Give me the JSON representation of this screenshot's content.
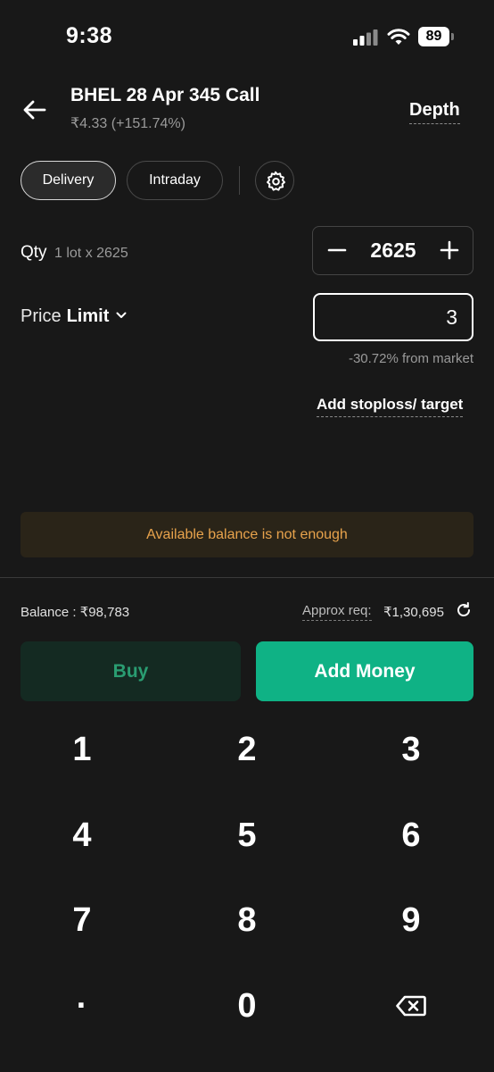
{
  "status_bar": {
    "time": "9:38",
    "battery": "89"
  },
  "header": {
    "title": "BHEL 28 Apr 345 Call",
    "subtitle": "₹4.33 (+151.74%)",
    "depth_label": "Depth"
  },
  "tabs": {
    "delivery": "Delivery",
    "intraday": "Intraday",
    "selected": "Delivery"
  },
  "qty": {
    "label": "Qty",
    "sub": "1 lot x 2625",
    "value": "2625"
  },
  "price": {
    "label": "Price",
    "type": "Limit",
    "value": "3",
    "from_market": "-30.72% from market"
  },
  "add_stoploss_label": "Add stoploss/ target",
  "warning": "Available balance is not enough",
  "balance": {
    "label": "Balance : ₹98,783"
  },
  "approx": {
    "label": "Approx req:",
    "value": "₹1,30,695"
  },
  "buttons": {
    "buy": "Buy",
    "add_money": "Add Money"
  },
  "keypad": {
    "k1": "1",
    "k2": "2",
    "k3": "3",
    "k4": "4",
    "k5": "5",
    "k6": "6",
    "k7": "7",
    "k8": "8",
    "k9": "9",
    "dot": "·",
    "k0": "0"
  },
  "colors": {
    "background": "#181818",
    "accent_green": "#0fb285",
    "buy_text": "#2a9d72",
    "warning_text": "#e8a34c",
    "warning_bg": "#2a2418"
  }
}
